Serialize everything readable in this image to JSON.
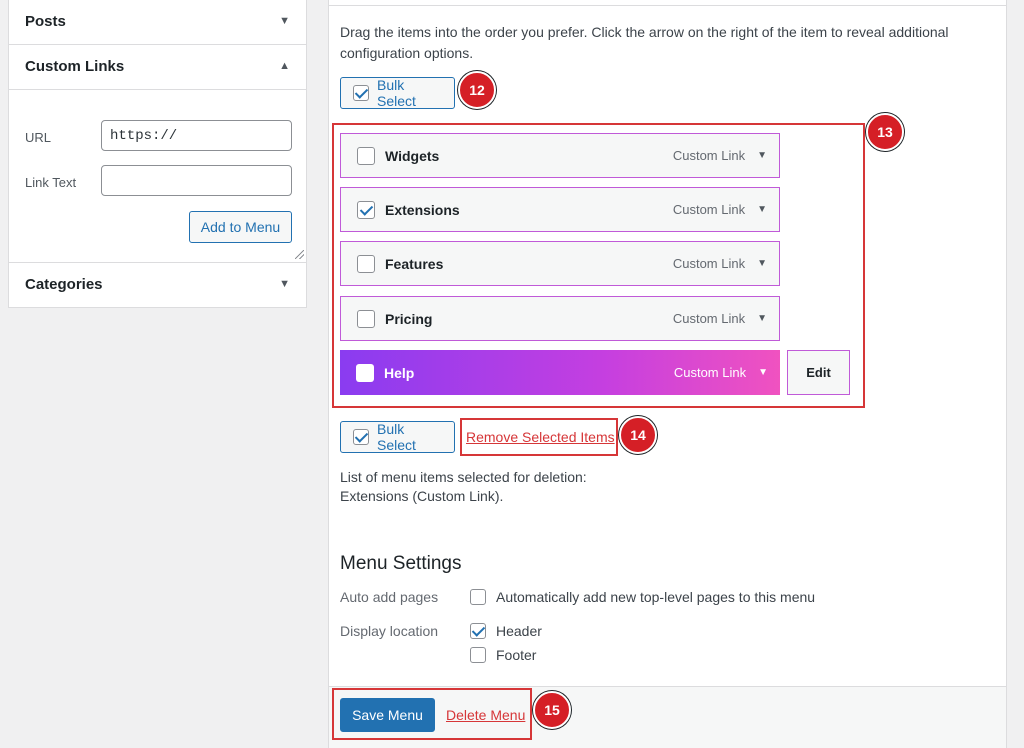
{
  "sidebar": {
    "sections": {
      "posts": {
        "title": "Posts"
      },
      "custom_links": {
        "title": "Custom Links",
        "url_label": "URL",
        "url_value": "https://",
        "link_text_label": "Link Text",
        "link_text_value": "",
        "add_button": "Add to Menu"
      },
      "categories": {
        "title": "Categories"
      }
    }
  },
  "menu_structure": {
    "instructions": "Drag the items into the order you prefer. Click the arrow on the right of the item to reveal additional configuration options.",
    "bulk_select_label": "Bulk Select",
    "items": [
      {
        "title": "Widgets",
        "type": "Custom Link",
        "checked": false
      },
      {
        "title": "Extensions",
        "type": "Custom Link",
        "checked": true
      },
      {
        "title": "Features",
        "type": "Custom Link",
        "checked": false
      },
      {
        "title": "Pricing",
        "type": "Custom Link",
        "checked": false
      },
      {
        "title": "Help",
        "type": "Custom Link",
        "checked": false,
        "highlighted": true
      }
    ],
    "edit_button": "Edit",
    "remove_selected": "Remove Selected Items",
    "deletion_list_heading": "List of menu items selected for deletion:",
    "deletion_list_value": "Extensions (Custom Link)."
  },
  "menu_settings": {
    "title": "Menu Settings",
    "auto_add_label": "Auto add pages",
    "auto_add_option": "Automatically add new top-level pages to this menu",
    "auto_add_checked": false,
    "display_location_label": "Display location",
    "locations": [
      {
        "label": "Header",
        "checked": true
      },
      {
        "label": "Footer",
        "checked": false
      }
    ]
  },
  "footer": {
    "save_button": "Save Menu",
    "delete_link": "Delete Menu"
  },
  "annotations": [
    "12",
    "13",
    "14",
    "15"
  ],
  "colors": {
    "accent_blue": "#2271b1",
    "annotation_red": "#d63638",
    "badge_red": "#d51f26",
    "gradient_start": "#8a3cf0",
    "gradient_end": "#f052c0"
  }
}
